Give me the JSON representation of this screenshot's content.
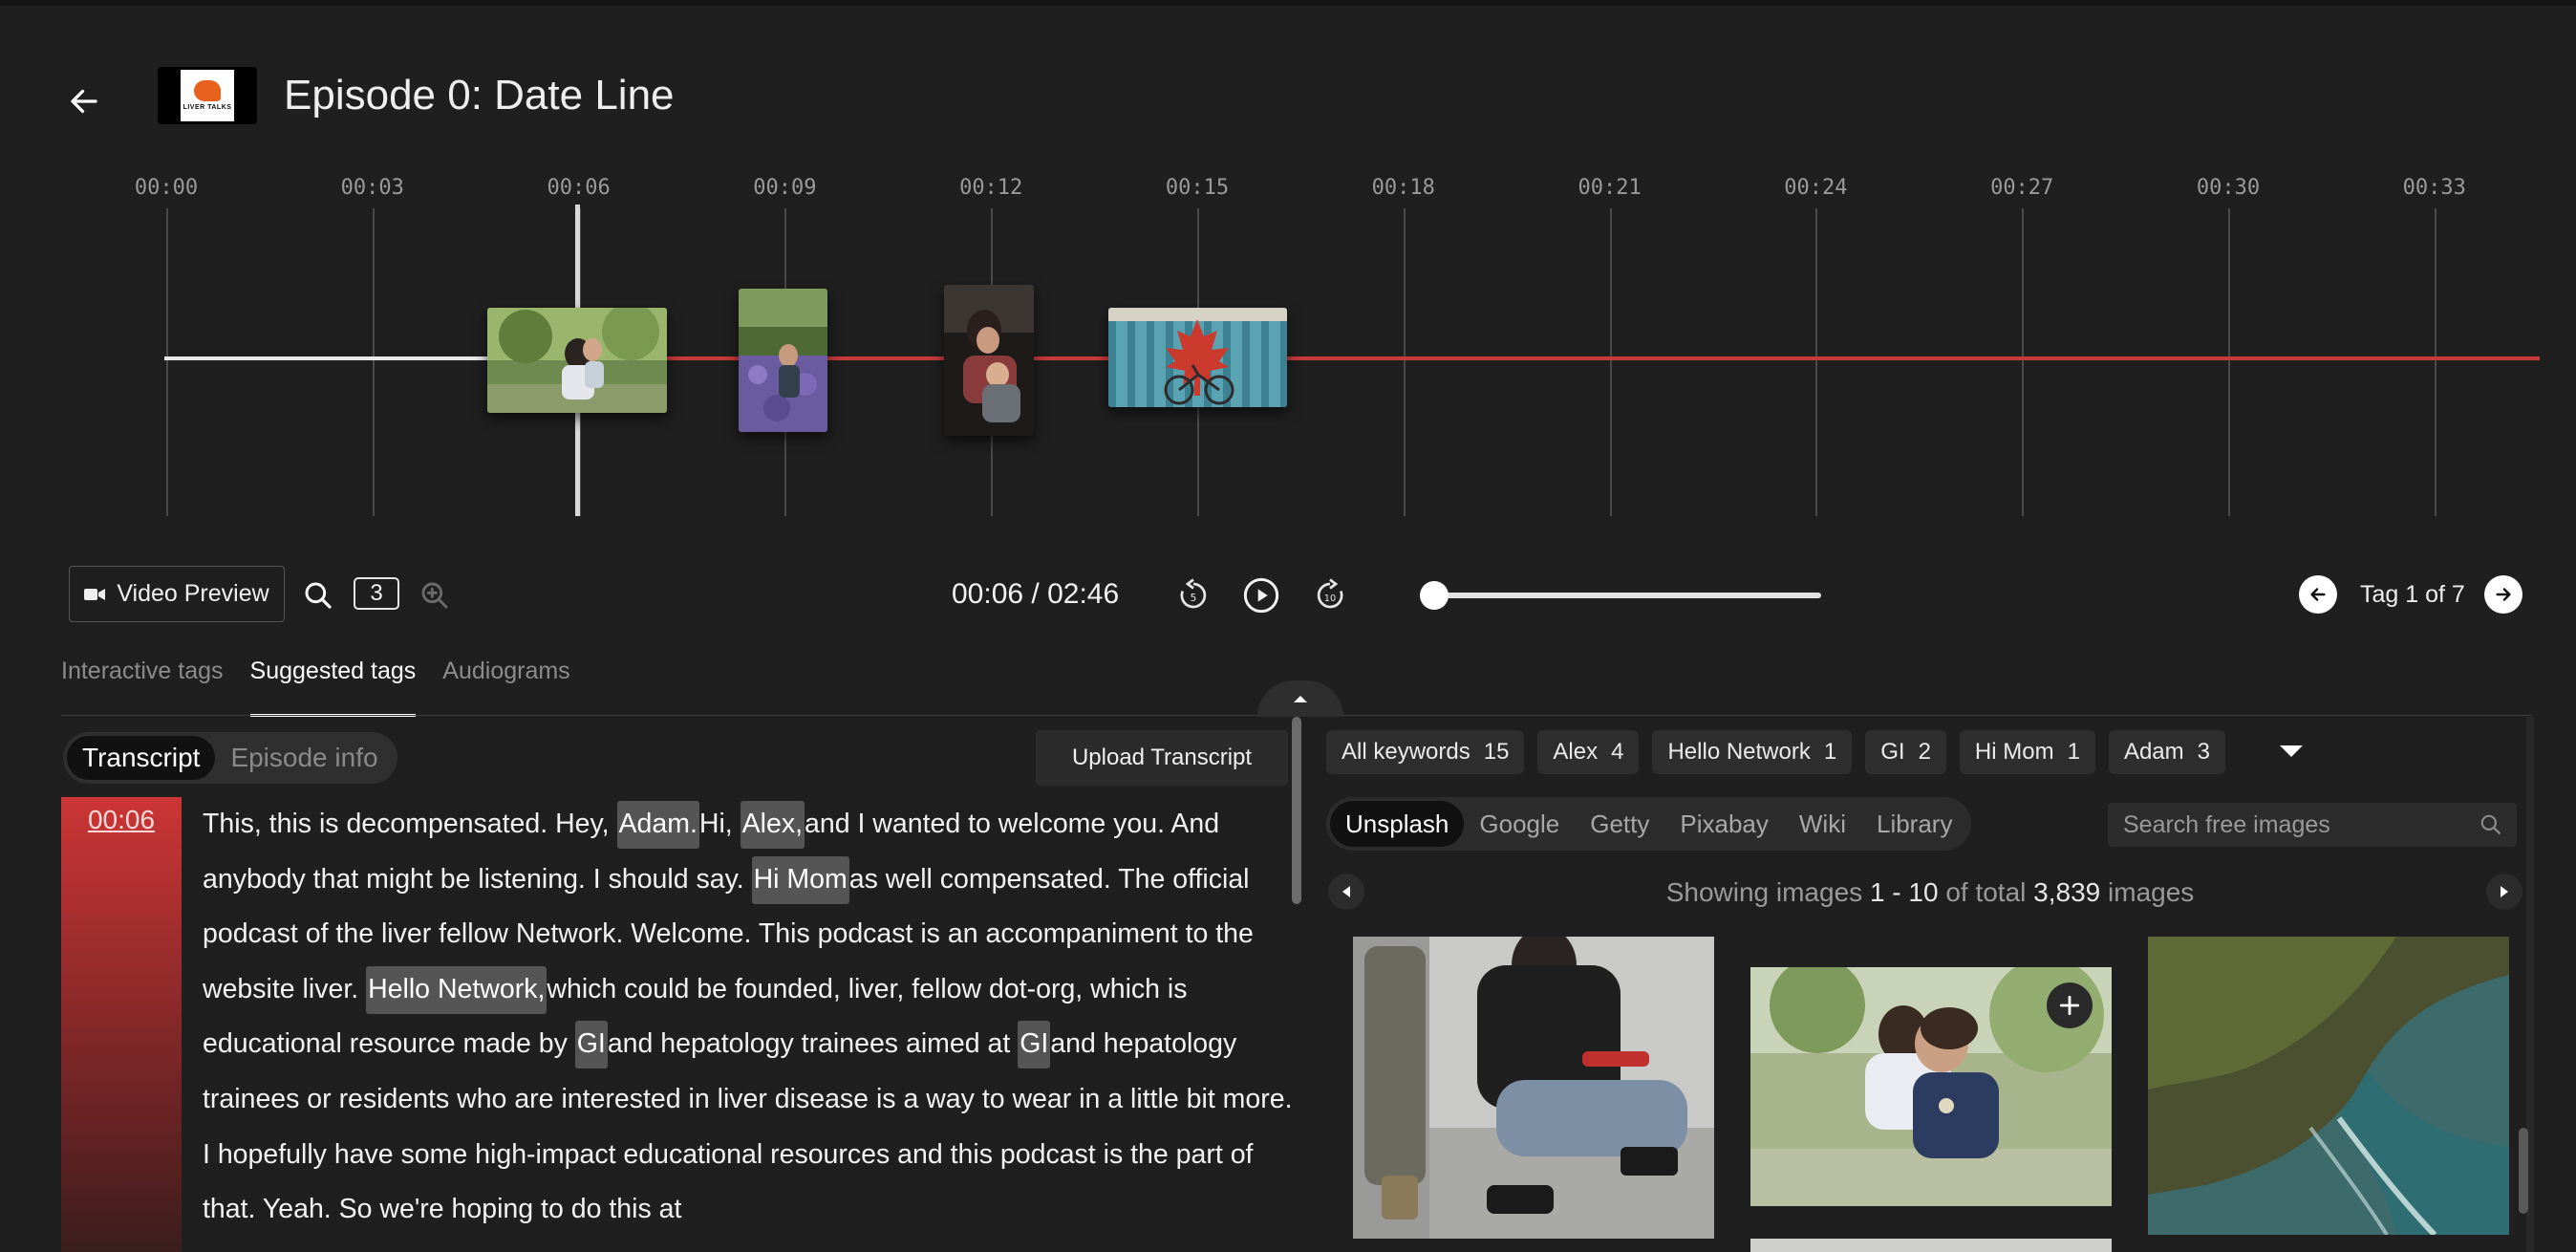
{
  "header": {
    "back_icon": "arrow-left-icon",
    "logo_text": "LIVER TALKS",
    "title": "Episode 0: Date Line"
  },
  "timeline": {
    "ticks": [
      "00:00",
      "00:03",
      "00:06",
      "00:09",
      "00:12",
      "00:15",
      "00:18",
      "00:21",
      "00:24",
      "00:27",
      "00:30",
      "00:33"
    ],
    "playhead_time": "00:06",
    "colors": {
      "active_track": "#c83a3a",
      "played_track": "#e8e8e8"
    },
    "thumbnails": [
      {
        "subject": "mother-and-child-park"
      },
      {
        "subject": "woman-lavender-field"
      },
      {
        "subject": "mother-hugging-child"
      },
      {
        "subject": "maple-leaf-mural-bicycle"
      }
    ]
  },
  "controls": {
    "video_preview_label": "Video Preview",
    "video_icon": "video-camera-icon",
    "zoom_out_icon": "zoom-out-icon",
    "zoom_level": "3",
    "zoom_in_icon": "zoom-in-icon",
    "time": "00:06 / 02:46",
    "rewind_icon": "rewind-icon",
    "play_icon": "play-icon",
    "forward_icon": "fast-forward-icon",
    "scrubber_progress": 0.0,
    "tag_counter": "Tag 1 of 7"
  },
  "tabs": [
    {
      "label": "Interactive tags",
      "active": false
    },
    {
      "label": "Suggested tags",
      "active": true
    },
    {
      "label": "Audiograms",
      "active": false
    }
  ],
  "left_panel": {
    "toggle": [
      {
        "label": "Transcript",
        "active": true
      },
      {
        "label": "Episode info",
        "active": false
      }
    ],
    "upload_label": "Upload Transcript",
    "timestamp": "00:06",
    "transcript_segments": [
      {
        "t": "This, this is decompensated. Hey, "
      },
      {
        "t": "Adam.",
        "kw": true
      },
      {
        "t": "Hi, "
      },
      {
        "t": "Alex,",
        "kw": true
      },
      {
        "t": "and I wanted to welcome you. And anybody that might be listening. I should say. "
      },
      {
        "t": "Hi Mom",
        "kw": true
      },
      {
        "t": "as well compensated. The official podcast of the liver fellow Network. Welcome. This podcast is an accompaniment to the website liver. "
      },
      {
        "t": "Hello Network,",
        "kw": true
      },
      {
        "t": "which could be founded, liver, fellow dot-org, which is educational resource made by "
      },
      {
        "t": "GI",
        "kw": true
      },
      {
        "t": "and hepatology trainees aimed at "
      },
      {
        "t": "GI",
        "kw": true
      },
      {
        "t": "and hepatology trainees or residents who are interested in liver disease is a way to wear in a little bit more. I hopefully have some high-impact educational resources and this podcast is the part of that. Yeah. So we're hoping to do this at"
      }
    ]
  },
  "right_panel": {
    "keyword_chips": [
      {
        "label": "All keywords",
        "count": "15"
      },
      {
        "label": "Alex",
        "count": "4"
      },
      {
        "label": "Hello Network",
        "count": "1"
      },
      {
        "label": "GI",
        "count": "2"
      },
      {
        "label": "Hi Mom",
        "count": "1"
      },
      {
        "label": "Adam",
        "count": "3"
      }
    ],
    "more_icon": "caret-down-icon",
    "sources": [
      {
        "label": "Unsplash",
        "active": true
      },
      {
        "label": "Google",
        "active": false
      },
      {
        "label": "Getty",
        "active": false
      },
      {
        "label": "Pixabay",
        "active": false
      },
      {
        "label": "Wiki",
        "active": false
      },
      {
        "label": "Library",
        "active": false
      }
    ],
    "search_placeholder": "Search free images",
    "search_icon": "search-icon",
    "showing_prefix": "Showing images",
    "showing_range": "1 - 10",
    "showing_mid": "of total",
    "showing_total": "3,839",
    "showing_suffix": "images",
    "results": [
      {
        "subject": "parent-kneeling-with-toddler-street"
      },
      {
        "subject": "mother-and-child-park"
      },
      {
        "subject": "coastal-cliffs-ocean"
      },
      {
        "subject": "partial-image-below"
      }
    ],
    "add_icon": "plus-icon"
  }
}
